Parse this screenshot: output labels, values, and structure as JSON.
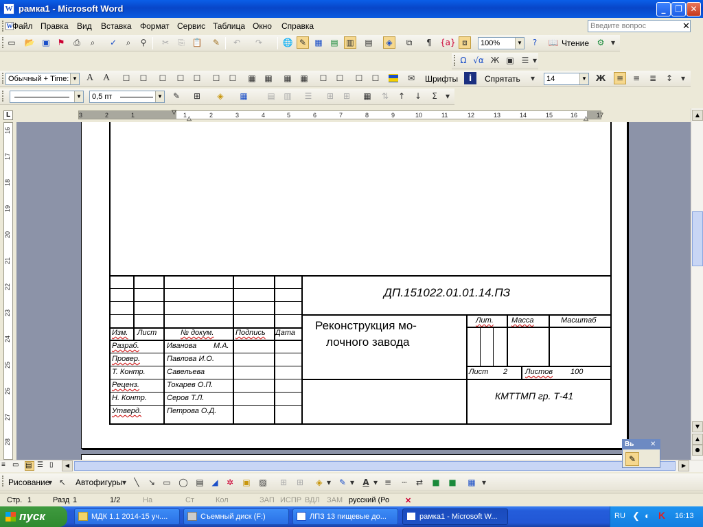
{
  "window": {
    "title": "рамка1 - Microsoft Word",
    "app_icon": "W"
  },
  "menu": {
    "items": [
      "Файл",
      "Правка",
      "Вид",
      "Вставка",
      "Формат",
      "Сервис",
      "Таблица",
      "Окно",
      "Справка"
    ],
    "ask_placeholder": "Введите вопрос"
  },
  "toolbar_std": {
    "zoom": "100%",
    "reading_label": "Чтение"
  },
  "toolbar_fmt": {
    "style": "Обычный + Time:",
    "fonts_label": "Шрифты",
    "hide_label": "Спрятать",
    "size": "14",
    "bold_label": "Ж"
  },
  "toolbar_tbl": {
    "line_weight": "0,5 пт"
  },
  "ruler": {
    "h_labels": [
      "3",
      "2",
      "1",
      "1",
      "2",
      "3",
      "4",
      "5",
      "6",
      "7",
      "8",
      "9",
      "10",
      "11",
      "12",
      "13",
      "14",
      "15",
      "16",
      "17"
    ],
    "v_labels": [
      "16",
      "17",
      "18",
      "19",
      "20",
      "21",
      "22",
      "23",
      "24",
      "25",
      "26",
      "27",
      "28"
    ]
  },
  "stamp": {
    "doc_code": "ДП.151022.01.01.14.ПЗ",
    "title_line1": "Реконструкция мо-",
    "title_line2": "лочного завода",
    "col_headers": [
      "Изм.",
      "Лист",
      "№ докум.",
      "Подпись",
      "Дата"
    ],
    "roles": [
      "Разраб.",
      "Провер.",
      "Т. Контр.",
      "Реценз.",
      "Н. Контр.",
      "Утверд."
    ],
    "names": [
      "Иванова",
      "Павлова И.О.",
      "Савельева",
      "Токарев О.П.",
      "Серов Т.Л.",
      "Петрова О.Д."
    ],
    "first_initials": "М.А.",
    "lit_label": "Лит.",
    "mass_label": "Масса",
    "scale_label": "Масштаб",
    "sheet_label": "Лист",
    "sheet_value": "2",
    "sheets_label": "Листов",
    "sheets_value": "100",
    "org": "КМТТМП гр. Т-41"
  },
  "drawing_bar": {
    "drawing_label": "Рисование",
    "autoshapes_label": "Автофигуры"
  },
  "status": {
    "page": "Стр.",
    "page_no": "1",
    "section": "Разд",
    "section_no": "1",
    "pages": "1/2",
    "at": "На",
    "line": "Ст",
    "col": "Кол",
    "rec": "ЗАП",
    "trk": "ИСПР",
    "ext": "ВДЛ",
    "ovr": "ЗАМ",
    "lang": "русский (Ро"
  },
  "taskbar": {
    "start_label": "пуск",
    "tasks": [
      "МДК 1.1 2014-15 уч....",
      "Съемный диск (F:)",
      "ЛПЗ 13 пищевые до...",
      "рамка1 - Microsoft W..."
    ],
    "lang": "RU",
    "clock": "16:13"
  },
  "float_panel": {
    "label": "Вь"
  }
}
